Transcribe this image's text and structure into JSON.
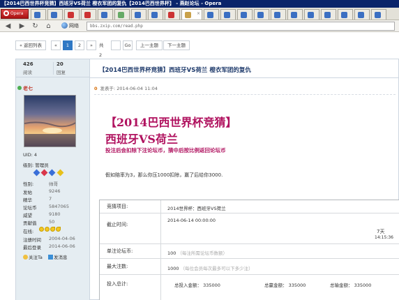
{
  "window": {
    "title": "【2014巴西世界杯竞猜】西班牙VS荷兰  橙衣军团的复仇【2014巴西世界杯】 - 燕赵论坛 - Opera",
    "suffix": "- 燕赵论坛 - Opera"
  },
  "tabs": {
    "opera_label": "Opera",
    "items": [
      {
        "icon": "forum-icon",
        "label": ""
      },
      {
        "icon": "forum-icon",
        "label": ""
      },
      {
        "icon": "red-icon",
        "label": ""
      },
      {
        "icon": "vs-icon",
        "label": ""
      },
      {
        "icon": "forum-icon",
        "label": ""
      },
      {
        "icon": "forum-icon",
        "label": ""
      },
      {
        "icon": "home-icon",
        "label": ""
      }
    ]
  },
  "addressbar": {
    "web_label": "网络",
    "url": "bbs.zxip.com/read.php"
  },
  "pager": {
    "back_list": "« 返回列表",
    "prev": "«",
    "page1": "1",
    "page2": "2",
    "next": "»",
    "total": "共2页",
    "go": "Go",
    "prev_topic": "上一主题",
    "next_topic": "下一主题"
  },
  "thread": {
    "views": "426",
    "views_label": "阅读",
    "replies": "20",
    "replies_label": "回复",
    "title": "【2014巴西世界杯竞猜】西班牙VS荷兰  橙衣军团的复仇",
    "floor": "0",
    "posted_at": "发表于: 2014-06-04 11:04"
  },
  "user": {
    "name": "老七",
    "uid": "UID: 4",
    "level": "级别: 管理员",
    "fields": [
      {
        "k": "性别:",
        "v": "帅哥"
      },
      {
        "k": "发帖",
        "v": "9246"
      },
      {
        "k": "精华",
        "v": "7"
      },
      {
        "k": "论坛币",
        "v": "5847065"
      },
      {
        "k": "威望",
        "v": "9180"
      },
      {
        "k": "贡献值",
        "v": "50"
      },
      {
        "k": "在线:",
        "v": ""
      },
      {
        "k": "注册时间",
        "v": "2004-04-06"
      },
      {
        "k": "最后登录",
        "v": "2014-06-06"
      }
    ],
    "follow": "关注Ta",
    "message": "发消息"
  },
  "post": {
    "headline1": "【2014巴西世界杯竞猜】",
    "headline2": "西班牙VS荷兰",
    "promo": "投注后会扣除下注论坛币，猜中后按比例返回论坛币",
    "body": "假如赔率为3，那么你压1000扣除，赢了后给你3000."
  },
  "bet": {
    "project_label": "竞猜项目:",
    "project_value": "2014世界杯：西班牙VS荷兰",
    "deadline_label": "截止时间:",
    "deadline_value": "2014-06-14 00:00:00",
    "remain_days": "7天",
    "remain_time": "14:15:36",
    "unit_label": "单注论坛币:",
    "unit_value": "100",
    "unit_hint": "（每注所需论坛币数额）",
    "max_label": "最大注数:",
    "max_value": "1000",
    "max_hint": "（每位会员每次最多可以下多少注）",
    "total_label": "投入总计:",
    "total_in": "总投入金额：  335000",
    "total_win": "总赢金额：  335000",
    "total_out": "总输金额：  335000"
  }
}
